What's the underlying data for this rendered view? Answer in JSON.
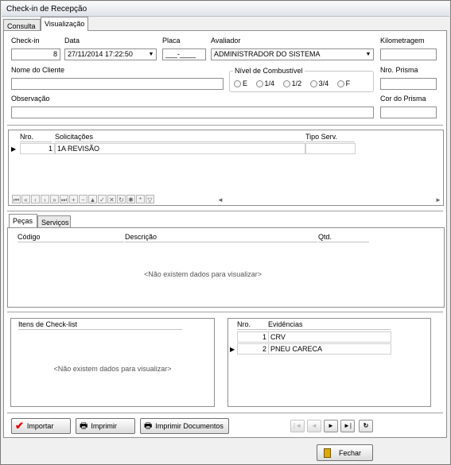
{
  "window": {
    "title": "Check-in de Recepção"
  },
  "tabs": [
    {
      "label": "Consulta"
    },
    {
      "label": "Visualização"
    }
  ],
  "form": {
    "checkin": {
      "label": "Check-in",
      "value": "8"
    },
    "data": {
      "label": "Data",
      "value": "27/11/2014 17:22:50"
    },
    "placa": {
      "label": "Placa",
      "value": "___-____"
    },
    "avaliador": {
      "label": "Avaliador",
      "value": "ADMINISTRADOR DO SISTEMA"
    },
    "kilometragem": {
      "label": "Kilometragem",
      "value": ""
    },
    "nome_cliente": {
      "label": "Nome do Cliente",
      "value": ""
    },
    "combustivel": {
      "label": "Nível de Combustível",
      "options": [
        "E",
        "1/4",
        "1/2",
        "3/4",
        "F"
      ]
    },
    "nro_prisma": {
      "label": "Nro. Prisma",
      "value": ""
    },
    "observacao": {
      "label": "Observação",
      "value": ""
    },
    "cor_prisma": {
      "label": "Cor do Prisma",
      "value": ""
    }
  },
  "solicitacoes": {
    "headers": [
      "Nro.",
      "Solicitações",
      "Tipo Serv."
    ],
    "rows": [
      {
        "nro": "1",
        "solicitacao": "1A REVISÃO",
        "tipo": ""
      }
    ]
  },
  "subtabs": [
    {
      "label": "Peças"
    },
    {
      "label": "Serviços"
    }
  ],
  "pecas": {
    "headers": [
      "Código",
      "Descrição",
      "Qtd."
    ],
    "empty": "<Não existem dados para visualizar>"
  },
  "checklist": {
    "header": "Itens de Check-list",
    "empty": "<Não existem dados para visualizar>"
  },
  "evidencias": {
    "headers": [
      "Nro.",
      "Evidências"
    ],
    "rows": [
      {
        "nro": "1",
        "text": "CRV"
      },
      {
        "nro": "2",
        "text": "PNEU CARECA"
      }
    ]
  },
  "buttons": {
    "importar": "Importar",
    "imprimir": "Imprimir",
    "imprimir_docs": "Imprimir Documentos",
    "fechar": "Fechar"
  },
  "colors": {
    "accent": "#316ac5",
    "window_bg": "#f0f0f0"
  }
}
